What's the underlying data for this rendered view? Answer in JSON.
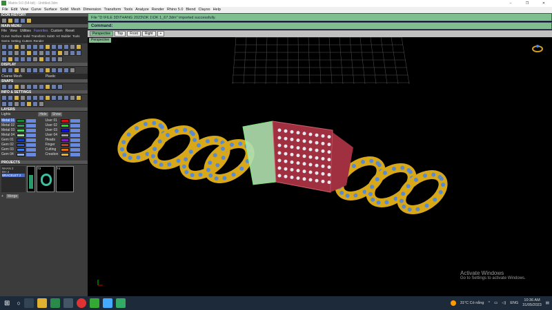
{
  "window": {
    "title": "Matrix 9.0 (64-bit) - Untitled.3dm"
  },
  "menu": [
    "File",
    "Edit",
    "View",
    "Curve",
    "Surface",
    "Solid",
    "Mesh",
    "Dimension",
    "Transform",
    "Tools",
    "Analyze",
    "Render",
    "Rhino 5.0",
    "Blend",
    "Clayoo",
    "Help"
  ],
  "panels": {
    "icon_history": "ICON HISTORY",
    "main_menu": "MAIN MENU",
    "display": "DISPLAY",
    "snaps": "SNAPS",
    "info": "INFO & SETTINGS",
    "layers": "LAYERS",
    "projects": "PROJECTS"
  },
  "main_menu": {
    "items": [
      "File",
      "View",
      "Utilities",
      "Favorites",
      "Custom",
      "Reset"
    ],
    "categories": [
      "Curve",
      "Surface",
      "Solid",
      "Transform",
      "SubD",
      "Art",
      "Builder",
      "Tools",
      "Gems",
      "Setting",
      "Cutters",
      "Render"
    ],
    "text_icon": "TT"
  },
  "display": {
    "left": "Coarse Mesh",
    "right": "Plastic"
  },
  "layers": {
    "lights": "Lights",
    "hide": "Hide",
    "show": "Show",
    "left": [
      {
        "name": "Metal 01",
        "color": "#1a8a3a"
      },
      {
        "name": "Metal 02",
        "color": "#2aa050"
      },
      {
        "name": "Metal 03",
        "color": "#50d060"
      },
      {
        "name": "Metal 04",
        "color": "#90e090"
      },
      {
        "name": "Gem 01",
        "color": "#1040c0"
      },
      {
        "name": "Gem 02",
        "color": "#2060e0"
      },
      {
        "name": "Gem 03",
        "color": "#4080f0"
      },
      {
        "name": "Gem 04",
        "color": "#80b0ff"
      }
    ],
    "right": [
      {
        "name": "User 01",
        "color": "#e01010"
      },
      {
        "name": "User 02",
        "color": "#20e020"
      },
      {
        "name": "User 03",
        "color": "#1010e0"
      },
      {
        "name": "User 04",
        "color": "#a0a0a0"
      },
      {
        "name": "Heads",
        "color": "#8020c0"
      },
      {
        "name": "Finger",
        "color": "#c04020"
      },
      {
        "name": "Cutting",
        "color": "#e07010"
      },
      {
        "name": "Creation",
        "color": "#f0b020"
      }
    ]
  },
  "projects": {
    "items": [
      "NHAN 2",
      "DH 2",
      "BRACELET 2"
    ],
    "selected": "BRACELET 2",
    "thumbs": [
      "",
      "73",
      "74"
    ],
    "merge": "Merge"
  },
  "status": {
    "message": "File \"D:\\FILE 3D\\THANG 2023\\OK 1\\OK 1_67.3dm\" imported successfully.",
    "command": "Command:"
  },
  "tabs": [
    "Perspective",
    "Top",
    "Front",
    "Right",
    "+"
  ],
  "viewport": {
    "label": "Perspective"
  },
  "watermark": {
    "title": "Activate Windows",
    "subtitle": "Go to Settings to activate Windows."
  },
  "taskbar": {
    "weather": "31°C  Có nắng",
    "lang": "ENG",
    "time": "10:36 AM",
    "date": "31/05/2023"
  }
}
